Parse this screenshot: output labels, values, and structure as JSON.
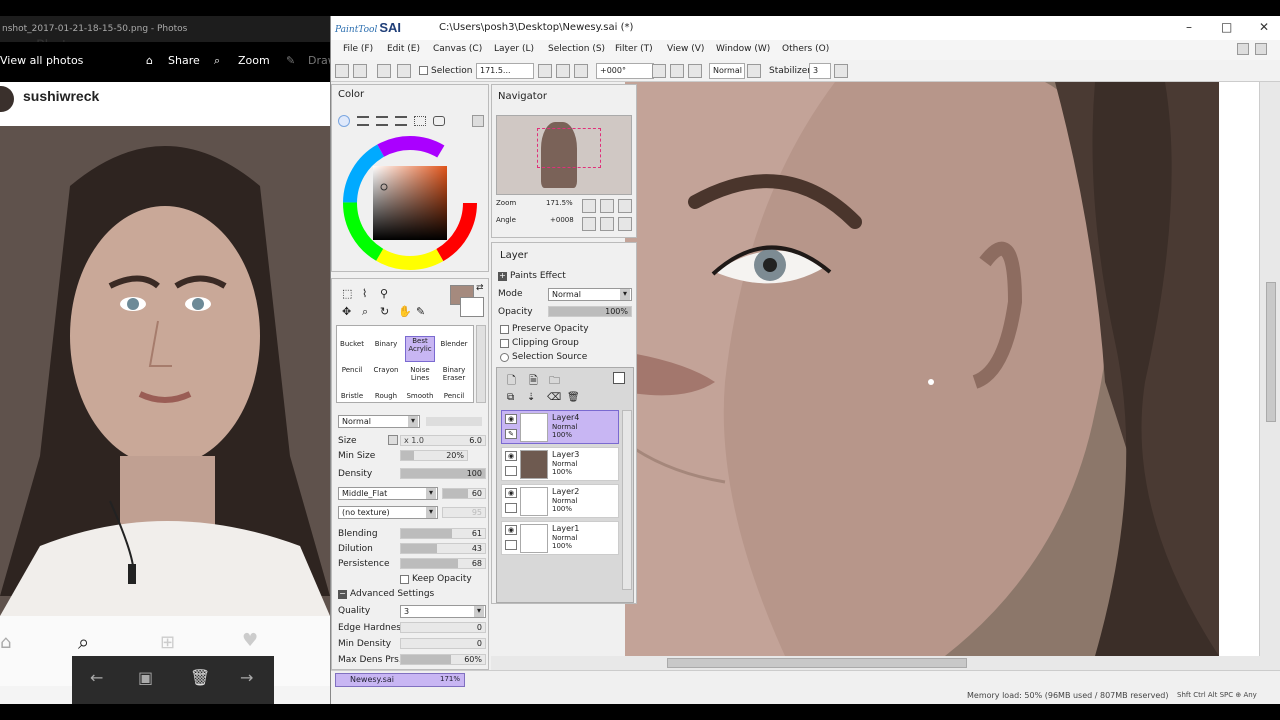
{
  "photos": {
    "title": "nshot_2017-01-21-18-15-50.png - Photos",
    "photo_label": "Photo",
    "view_all": "View all photos",
    "share": "Share",
    "zoom": "Zoom",
    "draw": "Draw",
    "username": "sushiwreck"
  },
  "sai": {
    "logo_small": "PaintTool",
    "logo_big": "SAI",
    "path": "C:\\Users\\posh3\\Desktop\\Newesy.sai (*)",
    "menu": [
      "File (F)",
      "Edit (E)",
      "Canvas (C)",
      "Layer (L)",
      "Selection (S)",
      "Filter (T)",
      "View (V)",
      "Window (W)",
      "Others (O)"
    ],
    "toolbar": {
      "selection_label": "Selection",
      "zoom_value": "171.5...",
      "angle_value": "+000°",
      "mode_value": "Normal",
      "stabilizer_label": "Stabilizer",
      "stabilizer_value": "3"
    },
    "color_panel": {
      "title": "Color"
    },
    "navigator": {
      "title": "Navigator",
      "zoom_label": "Zoom",
      "zoom_value": "171.5%",
      "angle_label": "Angle",
      "angle_value": "+0008"
    },
    "tools": {
      "row1": [
        "Bucket",
        "Binary",
        "Best Acrylic",
        "Blender"
      ],
      "row2": [
        "Pencil",
        "Crayon",
        "Noise Lines",
        "Binary Eraser"
      ],
      "row3": [
        "Bristle",
        "Rough",
        "Smooth",
        "Pencil"
      ],
      "blend_mode": "Normal",
      "size_label": "Size",
      "size_mult": "x 1.0",
      "size_value": "6.0",
      "min_size_label": "Min Size",
      "min_size_value": "20%",
      "min_size_level": 0.2,
      "density_label": "Density",
      "density_value": "100",
      "shape": "Middle_Flat",
      "shape_value": "60",
      "texture": "(no texture)",
      "texture_value": "95",
      "blending_label": "Blending",
      "blending_value": "61",
      "dilution_label": "Dilution",
      "dilution_value": "43",
      "persistence_label": "Persistence",
      "persistence_value": "68",
      "keep_opacity": "Keep Opacity",
      "advanced": "Advanced Settings",
      "quality_label": "Quality",
      "quality_value": "3",
      "edge_label": "Edge Hardness",
      "edge_value": "0",
      "min_density_label": "Min Density",
      "min_density_value": "0",
      "max_dens_label": "Max Dens Prs.",
      "max_dens_value": "60%"
    },
    "layer_panel": {
      "title": "Layer",
      "paints_effect": "Paints Effect",
      "mode_label": "Mode",
      "mode_value": "Normal",
      "opacity_label": "Opacity",
      "opacity_value": "100%",
      "preserve": "Preserve Opacity",
      "clipping": "Clipping Group",
      "selection_source": "Selection Source",
      "layers": [
        {
          "name": "Layer4",
          "mode": "Normal",
          "opacity": "100%"
        },
        {
          "name": "Layer3",
          "mode": "Normal",
          "opacity": "100%"
        },
        {
          "name": "Layer2",
          "mode": "Normal",
          "opacity": "100%"
        },
        {
          "name": "Layer1",
          "mode": "Normal",
          "opacity": "100%"
        }
      ]
    },
    "tab": {
      "name": "Newesy.sai",
      "zoom": "171%"
    },
    "status": "Memory load: 50% (96MB used / 807MB reserved)",
    "keys": "Shft Ctrl Alt SPC ⊕ Any"
  },
  "colors": {
    "accent": "#c8b6f3",
    "main_color": "#a58a7e"
  }
}
